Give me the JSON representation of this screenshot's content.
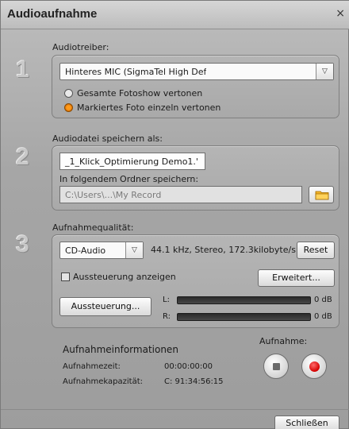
{
  "window": {
    "title": "Audioaufnahme",
    "close_glyph": "×"
  },
  "section1": {
    "step": "1",
    "label": "Audiotreiber:",
    "driver_value": "Hinteres MIC (SigmaTel High Def",
    "radio_all": "Gesamte Fotoshow vertonen",
    "radio_selected": "Markiertes Foto einzeln vertonen",
    "selected_radio": "radio_selected"
  },
  "section2": {
    "step": "2",
    "label": "Audiodatei speichern als:",
    "filename_value": "_1_Klick_Optimierung Demo1.'",
    "folder_label": "In folgendem Ordner speichern:",
    "folder_value": "C:\\Users\\...\\My Record"
  },
  "section3": {
    "step": "3",
    "label": "Aufnahmequalität:",
    "quality_value": "CD-Audio",
    "quality_info": "44.1 kHz, Stereo,  172.3kilobyte/s",
    "reset_label": "Reset",
    "show_level_label": "Aussteuerung anzeigen",
    "advanced_label": "Erweitert...",
    "level_button_label": "Aussteuerung...",
    "left_channel": "L:",
    "right_channel": "R:",
    "left_db": "0 dB",
    "right_db": "0 dB"
  },
  "info": {
    "heading": "Aufnahmeinformationen",
    "time_key": "Aufnahmezeit:",
    "time_value": "00:00:00:00",
    "capacity_key": "Aufnahmekapazität:",
    "capacity_value": "C: 91:34:56:15"
  },
  "record": {
    "label": "Aufnahme:"
  },
  "footer": {
    "close_label": "Schließen"
  },
  "colors": {
    "accent_orange": "#ff9a1a",
    "record_red": "#d40000"
  },
  "icons": [
    "close-icon",
    "chevron-down-icon",
    "folder-icon",
    "stop-icon",
    "record-icon"
  ]
}
